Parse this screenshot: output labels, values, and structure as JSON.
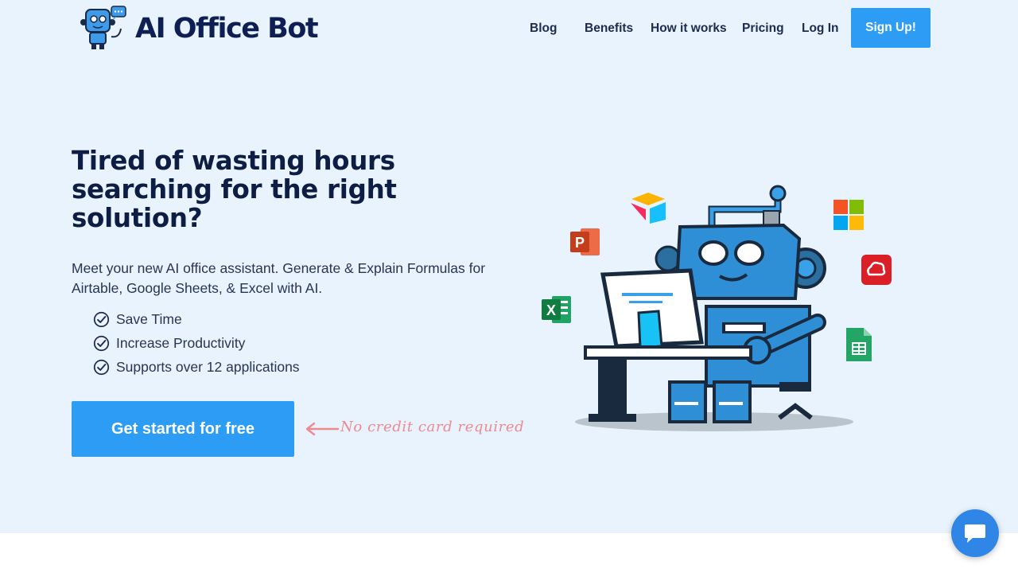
{
  "brand": {
    "name": "AI Office Bot"
  },
  "nav": {
    "items": [
      {
        "label": "Blog"
      },
      {
        "label": "Benefits"
      },
      {
        "label": "How it works"
      },
      {
        "label": "Pricing"
      },
      {
        "label": "Log In"
      }
    ],
    "signup_label": "Sign Up!"
  },
  "hero": {
    "title": "Tired of wasting hours searching for the right solution?",
    "subtitle": "Meet your new AI office assistant. Generate & Explain Formulas for Airtable, Google Sheets, & Excel with AI.",
    "features": [
      "Save Time",
      "Increase Productivity",
      "Supports over 12 applications"
    ],
    "cta_label": "Get started for free",
    "note": "No credit card required"
  },
  "icons": {
    "check": "check-circle-icon",
    "chat": "chat-bubble-icon",
    "apps": [
      "airtable-icon",
      "microsoft-icon",
      "powerpoint-icon",
      "creative-cloud-icon",
      "excel-icon",
      "google-sheets-icon"
    ]
  },
  "colors": {
    "background": "#e8f3fd",
    "primary": "#2c9cf5",
    "heading": "#0e1d44",
    "note": "#ee8a8f",
    "chat": "#2f86e6"
  }
}
